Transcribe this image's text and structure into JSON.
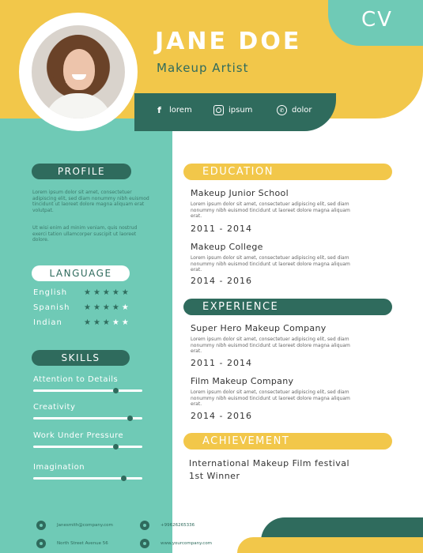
{
  "header": {
    "name": "JANE DOE",
    "title": "Makeup Artist",
    "cv_label": "CV"
  },
  "social": [
    {
      "icon": "facebook-icon",
      "label": "lorem"
    },
    {
      "icon": "instagram-icon",
      "label": "ipsum"
    },
    {
      "icon": "whatsapp-icon",
      "label": "dolor"
    }
  ],
  "profile": {
    "heading": "PROFILE",
    "text1": "Lorem ipsum dolor sit amet, consectetuer adipiscing elit, sed diam nonummy nibh euismod tincidunt ut laoreet dolore magna aliquam erat volutpat.",
    "text2": "Ut wisi enim ad minim veniam, quis nostrud exerci tation ullamcorper suscipit ut laoreet dolore."
  },
  "language": {
    "heading": "LANGUAGE",
    "items": [
      {
        "name": "English",
        "rating": 5
      },
      {
        "name": "Spanish",
        "rating": 4
      },
      {
        "name": "Indian",
        "rating": 3
      }
    ]
  },
  "skills": {
    "heading": "SKILLS",
    "items": [
      {
        "name": "Attention to Details",
        "level": 0.75
      },
      {
        "name": "Creativity",
        "level": 0.88
      },
      {
        "name": "Work Under Pressure",
        "level": 0.75
      },
      {
        "name": "Imagination",
        "level": 0.82
      }
    ]
  },
  "education": {
    "heading": "EDUCATION",
    "items": [
      {
        "title": "Makeup Junior School",
        "text": "Lorem ipsum dolor sit amet, consectetuer adipiscing elit, sed diam nonummy nibh euismod tincidunt ut laoreet dolore magna aliquam erat.",
        "years": "2011 - 2014"
      },
      {
        "title": "Makeup College",
        "text": "Lorem ipsum dolor sit amet, consectetuer adipiscing elit, sed diam nonummy nibh euismod tincidunt ut laoreet dolore magna aliquam erat.",
        "years": "2014 - 2016"
      }
    ]
  },
  "experience": {
    "heading": "EXPERIENCE",
    "items": [
      {
        "title": "Super Hero Makeup Company",
        "text": "Lorem ipsum dolor sit amet, consectetuer adipiscing elit, sed diam nonummy nibh euismod tincidunt ut laoreet dolore magna aliquam erat.",
        "years": "2011 - 2014"
      },
      {
        "title": "Film Makeup Company",
        "text": "Lorem ipsum dolor sit amet, consectetuer adipiscing elit, sed diam nonummy nibh euismod tincidunt ut laoreet dolore magna aliquam erat.",
        "years": "2014 - 2016"
      }
    ]
  },
  "achievement": {
    "heading": "ACHIEVEMENT",
    "line1": "International Makeup Film festival",
    "line2": "1st Winner"
  },
  "footer": {
    "email": "Janesmith@company.com",
    "phone": "+99626265336",
    "address": "North Street Avenue 56",
    "web": "www.yourcompany.com"
  },
  "colors": {
    "teal": "#6fcab6",
    "dark_green": "#2f6b5d",
    "yellow": "#f2c74a"
  }
}
